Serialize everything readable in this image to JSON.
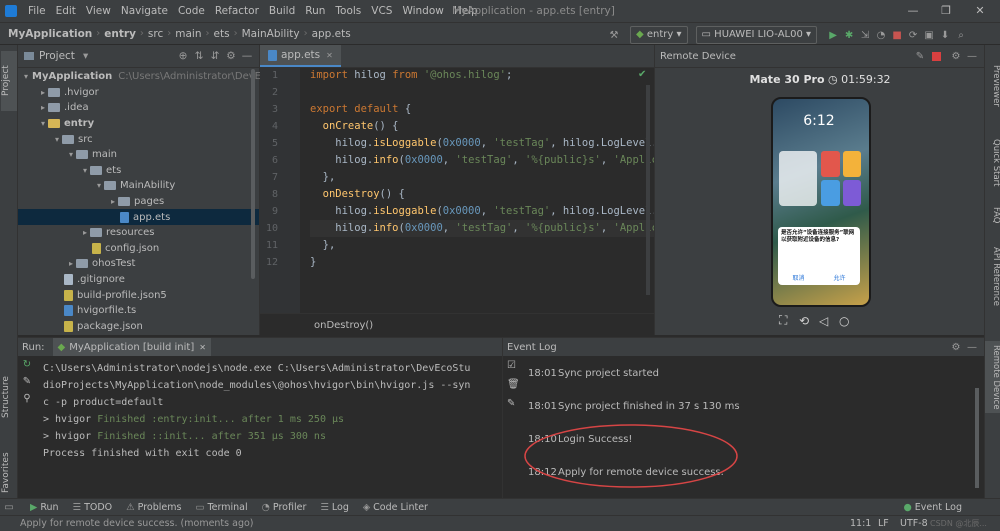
{
  "menu": [
    "File",
    "Edit",
    "View",
    "Navigate",
    "Code",
    "Refactor",
    "Build",
    "Run",
    "Tools",
    "VCS",
    "Window",
    "Help"
  ],
  "window_title": "MyApplication - app.ets [entry]",
  "breadcrumbs": [
    "MyApplication",
    "entry",
    "src",
    "main",
    "ets",
    "MainAbility",
    "app.ets"
  ],
  "toolbar": {
    "config": "entry",
    "device": "HUAWEI LIO-AL00"
  },
  "project_panel": {
    "title": "Project",
    "tree": [
      {
        "label": "MyApplication",
        "extra": "C:\\Users\\Administrator\\DevEc",
        "depth": 0,
        "expanded": true,
        "kind": "folder",
        "bold": true
      },
      {
        "label": ".hvigor",
        "depth": 1,
        "expanded": false,
        "kind": "folder"
      },
      {
        "label": ".idea",
        "depth": 1,
        "expanded": false,
        "kind": "folder"
      },
      {
        "label": "entry",
        "depth": 1,
        "expanded": true,
        "kind": "folder-y",
        "bold": true
      },
      {
        "label": "src",
        "depth": 2,
        "expanded": true,
        "kind": "folder"
      },
      {
        "label": "main",
        "depth": 3,
        "expanded": true,
        "kind": "folder"
      },
      {
        "label": "ets",
        "depth": 4,
        "expanded": true,
        "kind": "folder"
      },
      {
        "label": "MainAbility",
        "depth": 5,
        "expanded": true,
        "kind": "folder"
      },
      {
        "label": "pages",
        "depth": 6,
        "expanded": false,
        "kind": "folder"
      },
      {
        "label": "app.ets",
        "depth": 6,
        "kind": "file-ts",
        "selected": true
      },
      {
        "label": "resources",
        "depth": 4,
        "expanded": false,
        "kind": "folder"
      },
      {
        "label": "config.json",
        "depth": 4,
        "kind": "file-json"
      },
      {
        "label": "ohosTest",
        "depth": 3,
        "expanded": false,
        "kind": "folder"
      },
      {
        "label": ".gitignore",
        "depth": 2,
        "kind": "file"
      },
      {
        "label": "build-profile.json5",
        "depth": 2,
        "kind": "file-json"
      },
      {
        "label": "hvigorfile.ts",
        "depth": 2,
        "kind": "file-ts"
      },
      {
        "label": "package.json",
        "depth": 2,
        "kind": "file-json"
      }
    ]
  },
  "editor": {
    "tab": "app.ets",
    "lines": [
      [
        [
          "kw",
          "import "
        ],
        [
          "",
          "hilog "
        ],
        [
          "kw",
          "from "
        ],
        [
          "str",
          "'@ohos.hilog'"
        ],
        [
          "",
          ";"
        ]
      ],
      [],
      [
        [
          "kw",
          "export default "
        ],
        [
          "",
          "{"
        ]
      ],
      [
        [
          "fn",
          "  onCreate"
        ],
        [
          "",
          "() {"
        ]
      ],
      [
        [
          "",
          "    hilog."
        ],
        [
          "fn",
          "isLoggable"
        ],
        [
          "",
          "("
        ],
        [
          "num",
          "0x0000"
        ],
        [
          "",
          ", "
        ],
        [
          "str",
          "'testTag'"
        ],
        [
          "",
          ", hilog.LogLevel."
        ]
      ],
      [
        [
          "",
          "    hilog."
        ],
        [
          "fn",
          "info"
        ],
        [
          "",
          "("
        ],
        [
          "num",
          "0x0000"
        ],
        [
          "",
          ", "
        ],
        [
          "str",
          "'testTag'"
        ],
        [
          "",
          ", "
        ],
        [
          "str",
          "'%{public}s'"
        ],
        [
          "",
          ", "
        ],
        [
          "str",
          "'Applic"
        ]
      ],
      [
        [
          "",
          "  },"
        ]
      ],
      [
        [
          "fn",
          "  onDestroy"
        ],
        [
          "",
          "() {"
        ]
      ],
      [
        [
          "",
          "    hilog."
        ],
        [
          "fn",
          "isLoggable"
        ],
        [
          "",
          "("
        ],
        [
          "num",
          "0x0000"
        ],
        [
          "",
          ", "
        ],
        [
          "str",
          "'testTag'"
        ],
        [
          "",
          ", hilog.LogLevel."
        ]
      ],
      [
        [
          "",
          "    hilog."
        ],
        [
          "fn",
          "info"
        ],
        [
          "",
          "("
        ],
        [
          "num",
          "0x0000"
        ],
        [
          "",
          ", "
        ],
        [
          "str",
          "'testTag'"
        ],
        [
          "",
          ", "
        ],
        [
          "str",
          "'%{public}s'"
        ],
        [
          "",
          ", "
        ],
        [
          "str",
          "'Applic"
        ]
      ],
      [
        [
          "",
          "  },"
        ]
      ],
      [
        [
          "",
          "}"
        ]
      ]
    ],
    "breadcrumb": "onDestroy()"
  },
  "remote_device": {
    "title": "Remote Device",
    "model": "Mate 30 Pro",
    "time": "01:59:32",
    "phone_clock": "6:12",
    "dialog_title": "是否允许“设备连接服务”联网以获取附近设备的信息?",
    "dialog_cancel": "取消",
    "dialog_allow": "允许"
  },
  "right_tabs": [
    "Previewer",
    "Quick Start",
    "FAQ",
    "API Reference",
    "Remote Device"
  ],
  "left_tabs": [
    "Project",
    "Structure",
    "Favorites"
  ],
  "run_panel": {
    "label": "Run:",
    "tab": "MyApplication [build init]",
    "lines": [
      {
        "text": "C:\\Users\\Administrator\\nodejs\\node.exe C:\\Users\\Administrator\\DevEcoStu",
        "cls": ""
      },
      {
        "text": "dioProjects\\MyApplication\\node_modules\\@ohos\\hvigor\\bin\\hvigor.js --syn",
        "cls": ""
      },
      {
        "text": "c -p product=default",
        "cls": ""
      },
      {
        "text": "> hvigor Finished :entry:init... after 1 ms 250 μs",
        "cls": "green-tail"
      },
      {
        "text": "> hvigor Finished ::init... after 351 μs 300 ns",
        "cls": "green-tail"
      },
      {
        "text": "Process finished with exit code 0",
        "cls": ""
      }
    ]
  },
  "event_log": {
    "title": "Event Log",
    "entries": [
      {
        "time": "18:01",
        "msg": "Sync project started"
      },
      {
        "time": "18:01",
        "msg": "Sync project finished in 37 s 130 ms"
      },
      {
        "time": "18:10",
        "msg": "Login Success!"
      },
      {
        "time": "18:12",
        "msg": "Apply for remote device success."
      }
    ]
  },
  "tool_tabs": [
    "Run",
    "TODO",
    "Problems",
    "Terminal",
    "Profiler",
    "Log",
    "Code Linter"
  ],
  "event_log_tab": "Event Log",
  "status": {
    "message": "Apply for remote device success. (moments ago)",
    "position": "11:1",
    "line_sep": "LF",
    "encoding": "UTF-8",
    "indent": "2 spaces",
    "watermark": "CSDN @北辰..."
  },
  "colors": {
    "annotation": "#d64545",
    "accent": "#4a88c7"
  }
}
